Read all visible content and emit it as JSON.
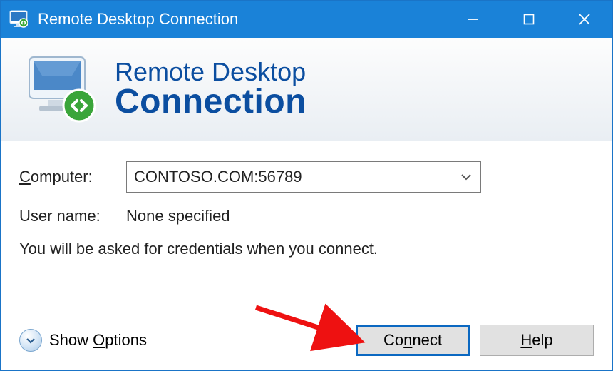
{
  "titlebar": {
    "title": "Remote Desktop Connection"
  },
  "banner": {
    "line1": "Remote Desktop",
    "line2": "Connection"
  },
  "form": {
    "computer_label_pre": "C",
    "computer_label_post": "omputer:",
    "computer_value": "CONTOSO.COM:56789",
    "username_label": "User name:",
    "username_value": "None specified",
    "info_text": "You will be asked for credentials when you connect."
  },
  "footer": {
    "show_options_pre": "Show ",
    "show_options_u": "O",
    "show_options_post": "ptions",
    "connect_pre": "Co",
    "connect_u": "n",
    "connect_post": "nect",
    "help_u": "H",
    "help_post": "elp"
  }
}
